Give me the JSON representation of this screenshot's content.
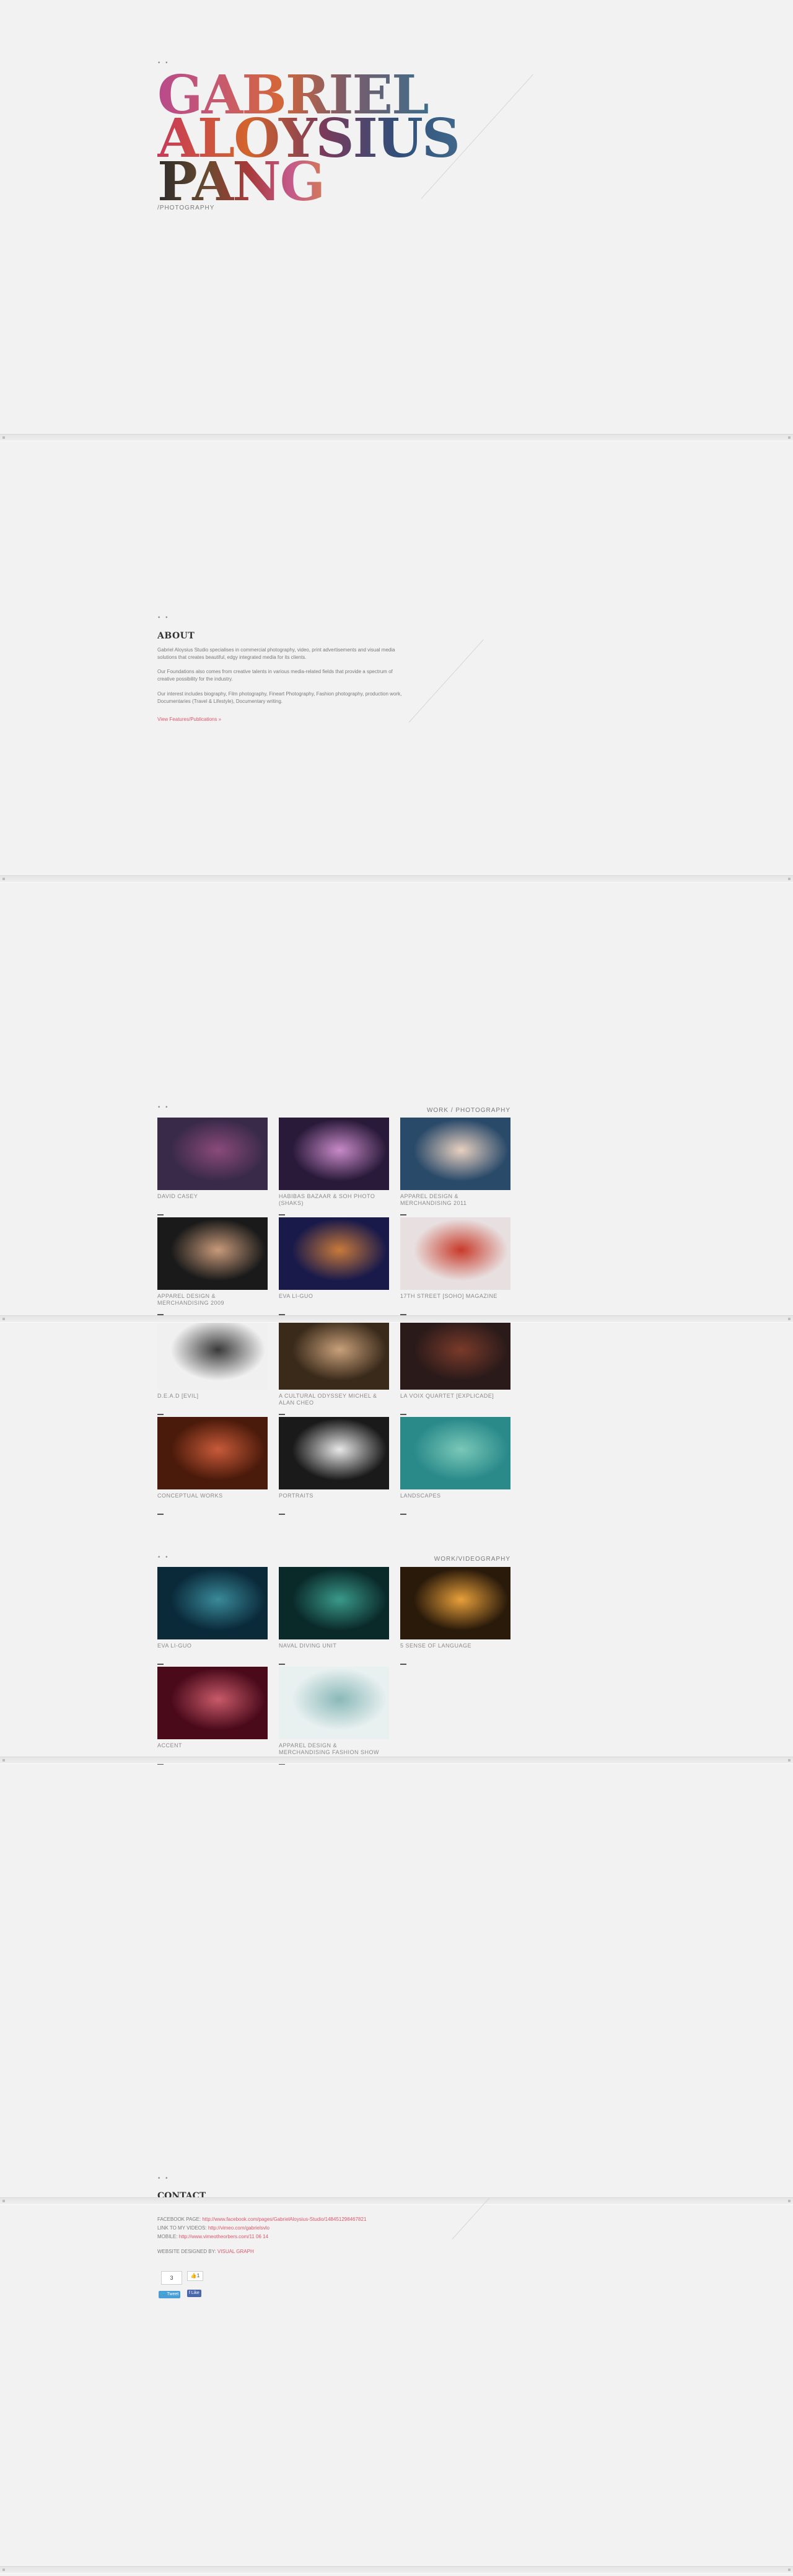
{
  "header": {
    "dots": "• •",
    "logo_line1": "GABRIEL",
    "logo_line2": "ALOYSIUS",
    "logo_line3": "PANG",
    "tagline": "/PHOTOGRAPHY"
  },
  "about": {
    "dots": "• •",
    "title": "ABOUT",
    "paragraphs": [
      "Gabriel Aloysius Studio specialises in commercial photography, video, print advertisements and visual media solutions that creates beautiful, edgy integrated media for its clients.",
      "Our Foundations also comes from creative talents in various media-related fields that provide a spectrum of creative possibility for the industry.",
      "Our interest includes biography, Film photography, Fineart Photography, Fashion photography, production work, Documentaries (Travel & Lifestyle), Documentary writing."
    ],
    "link": "View Features/Publications »"
  },
  "work_photo": {
    "dots": "• •",
    "heading": "WORK / PHOTOGRAPHY",
    "items": [
      {
        "label": "DAVID CASEY",
        "colors": [
          "#3a2a4a",
          "#8a4a7a",
          "#9ac83a"
        ]
      },
      {
        "label": "HABIBAS BAZAAR & SOH PHOTO (SHAKS)",
        "colors": [
          "#2a1a3a",
          "#c88ac8",
          "#5a3a6a"
        ]
      },
      {
        "label": "APPAREL DESIGN & MERCHANDISING 2011",
        "colors": [
          "#2a4a6a",
          "#e8d0c0",
          "#1a3a5a"
        ]
      },
      {
        "label": "APPAREL DESIGN & MERCHANDISING 2009",
        "colors": [
          "#1a1a1a",
          "#c89a7a",
          "#6a6a6a"
        ]
      },
      {
        "label": "EVA LI-GUO",
        "colors": [
          "#1a1a4a",
          "#c87a3a",
          "#0a0a2a"
        ]
      },
      {
        "label": "17TH STREET [SOHO] MAGAZINE",
        "colors": [
          "#e8e0e0",
          "#c83a2a",
          "#d8c8c8"
        ]
      },
      {
        "label": "D.E.A.D [EVIL]",
        "colors": [
          "#f0f0f0",
          "#3a3a3a",
          "#c8c8c8"
        ]
      },
      {
        "label": "A CULTURAL ODYSSEY MICHEL & ALAN CHEO",
        "colors": [
          "#3a2a1a",
          "#c8a07a",
          "#8a5a3a"
        ]
      },
      {
        "label": "LA VOIX QUARTET [EXPLICADE]",
        "colors": [
          "#2a1a1a",
          "#7a3a2a",
          "#1a0a0a"
        ]
      },
      {
        "label": "CONCEPTUAL WORKS",
        "colors": [
          "#4a1a0a",
          "#c85a3a",
          "#e8a07a"
        ]
      },
      {
        "label": "PORTRAITS",
        "colors": [
          "#1a1a1a",
          "#e8e8e8",
          "#5a5a5a"
        ]
      },
      {
        "label": "LANDSCAPES",
        "colors": [
          "#2a8a8a",
          "#7ac8b8",
          "#0a5a6a"
        ]
      }
    ]
  },
  "work_video": {
    "dots": "• •",
    "heading": "WORK/VIDEOGRAPHY",
    "items": [
      {
        "label": "EVA LI-GUO",
        "colors": [
          "#0a2a3a",
          "#3a8a9a",
          "#1a1a2a"
        ]
      },
      {
        "label": "NAVAL DIVING UNIT",
        "colors": [
          "#0a2a2a",
          "#3a9a8a",
          "#0a1a1a"
        ]
      },
      {
        "label": "5 SENSE OF LANGUAGE",
        "colors": [
          "#2a1a0a",
          "#e8a03a",
          "#1a0a0a"
        ]
      },
      {
        "label": "ACCENT",
        "colors": [
          "#4a0a1a",
          "#c85a6a",
          "#8a2a3a"
        ]
      },
      {
        "label": "APPAREL DESIGN & MERCHANDISING FASHION SHOW TRAILER",
        "colors": [
          "#e8f0f0",
          "#8ab8b8",
          "#3a3a3a"
        ]
      }
    ]
  },
  "contact": {
    "dots": "• •",
    "title": "CONTACT",
    "facebook_label": "FACEBOOK PAGE: ",
    "facebook_url": "http://www.facebook.com/pages/GabrielAloysius-Studio/148451298467821",
    "vimeo_label": "LINK TO MY VIDEOS: ",
    "vimeo_url": "http://vimeo.com/gabrielsvlo",
    "mobile_label": "MOBILE: ",
    "mobile_value": "http://www.vimeotheorbers.com/11 06 14",
    "designer_label": "WEBSITE DESIGNED BY: ",
    "designer_name": "VISUAL GRAPH",
    "share_count": "3",
    "fb_count": "1",
    "tweet_label": "Tweet",
    "like_label": "Like"
  }
}
